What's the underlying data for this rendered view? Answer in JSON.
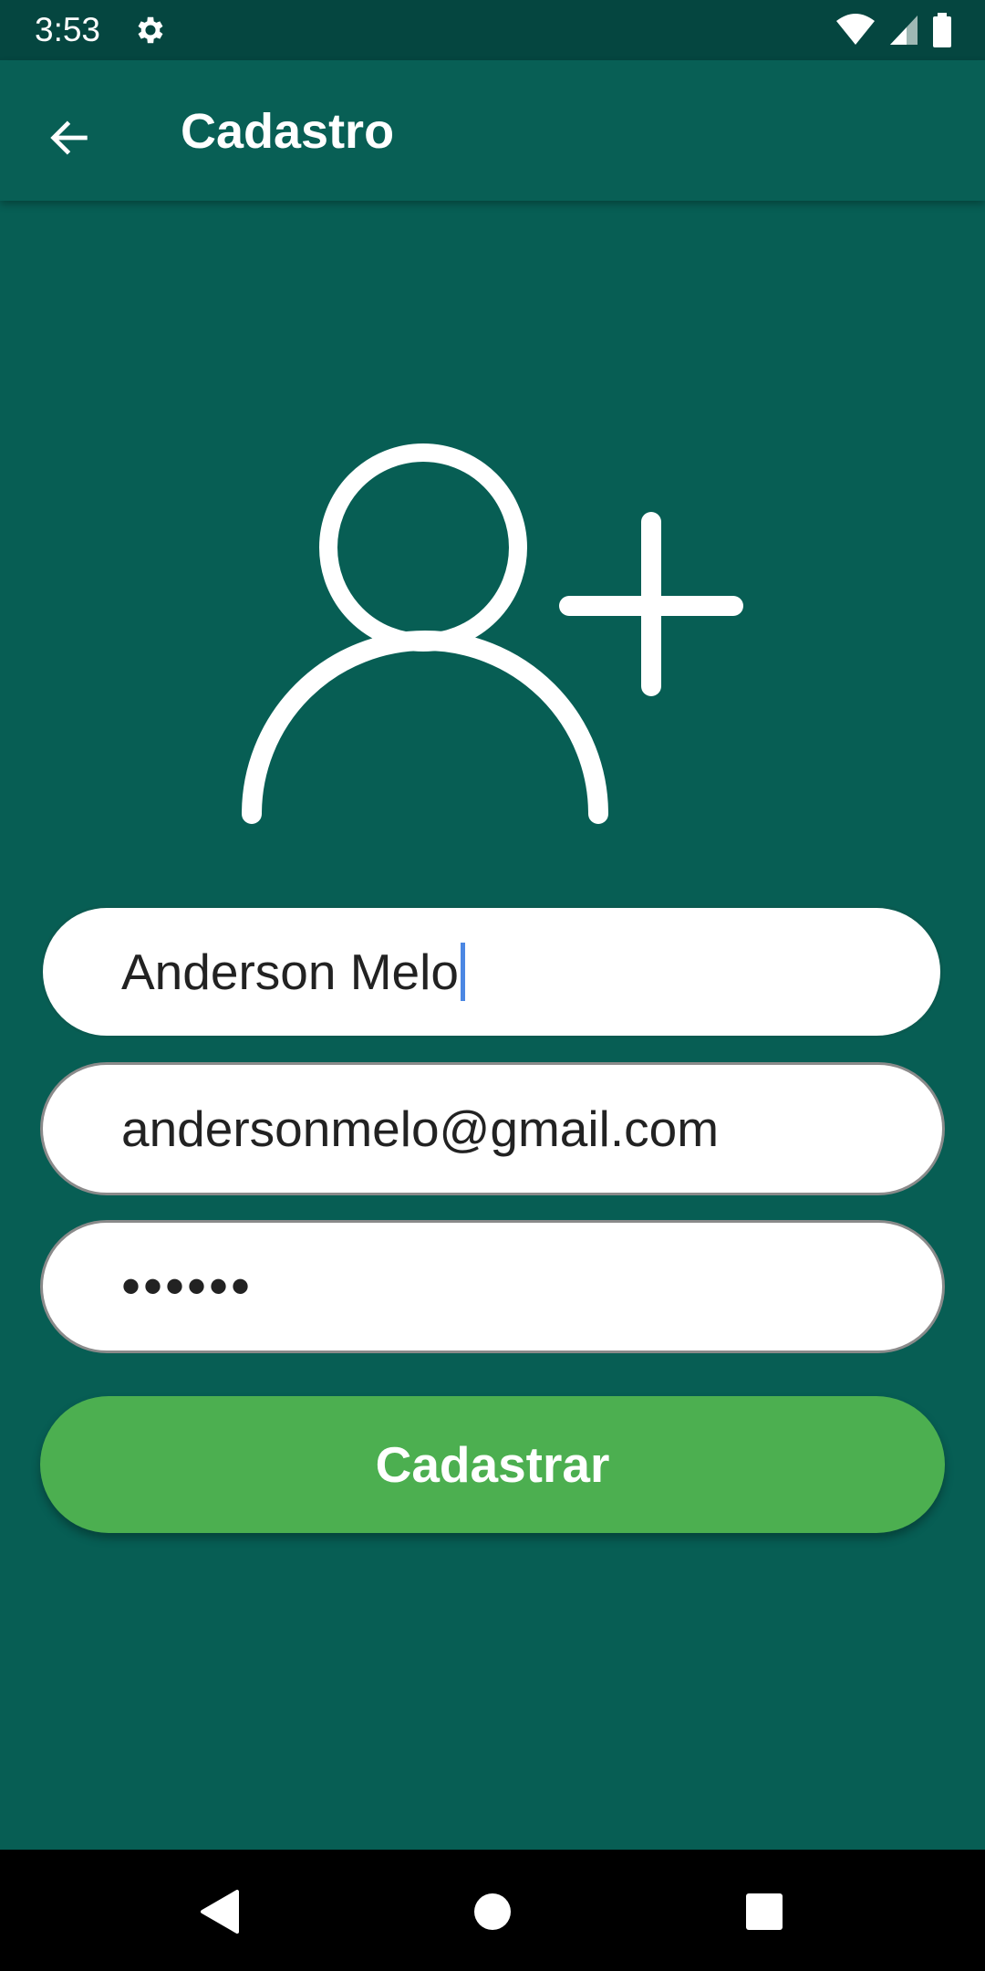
{
  "status_bar": {
    "time": "3:53",
    "icons": [
      "settings-icon",
      "wifi-icon",
      "cell-signal-icon",
      "battery-icon"
    ]
  },
  "app_bar": {
    "title": "Cadastro",
    "back_icon": "arrow-back-icon"
  },
  "hero_icon": "add-user-icon",
  "form": {
    "name_value": "Anderson Melo",
    "email_value": "andersonmelo@gmail.com",
    "password_value": "••••••",
    "submit_label": "Cadastrar"
  },
  "nav_bar": {
    "items": [
      "back-triangle-icon",
      "home-circle-icon",
      "recents-square-icon"
    ]
  },
  "colors": {
    "background": "#075E54",
    "status_bar": "#054640",
    "button": "#4CAF50",
    "cursor": "#4B87E3"
  }
}
